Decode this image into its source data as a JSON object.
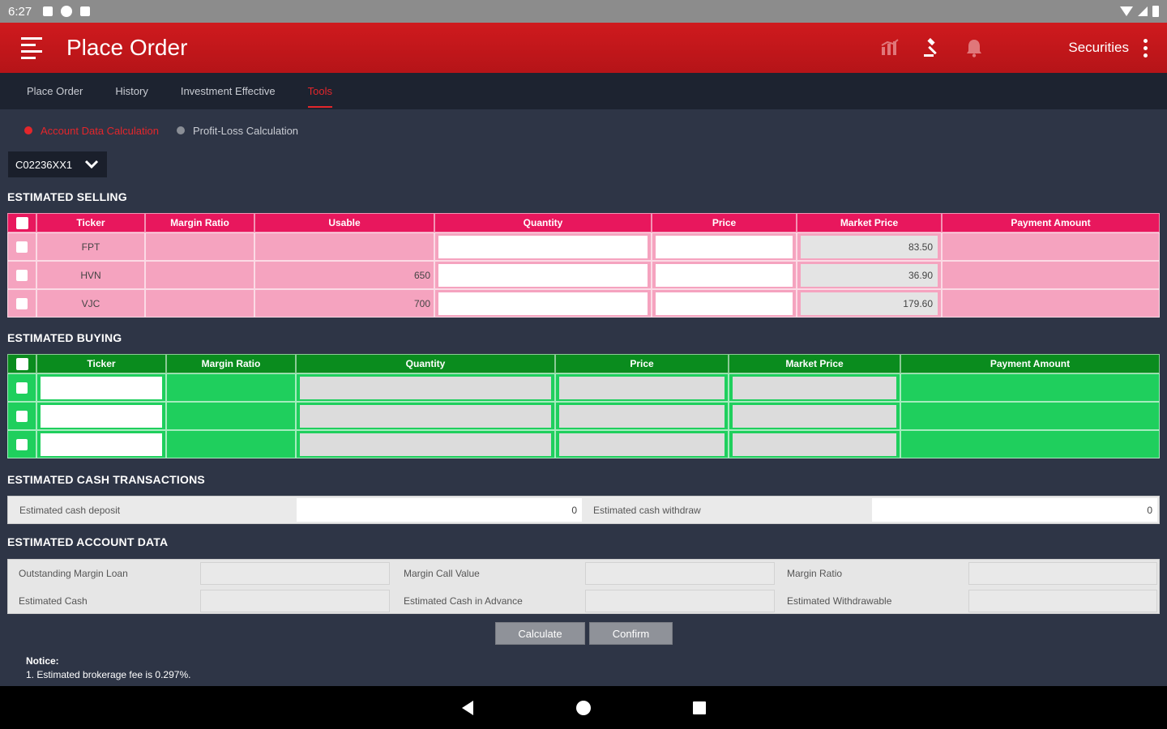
{
  "status_bar": {
    "time": "6:27"
  },
  "app_bar": {
    "title": "Place Order",
    "securities_label": "Securities"
  },
  "tabs": [
    {
      "label": "Place Order"
    },
    {
      "label": "History"
    },
    {
      "label": "Investment Effective"
    },
    {
      "label": "Tools",
      "active": true
    }
  ],
  "sub_tabs": [
    {
      "label": "Account Data Calculation",
      "active": true
    },
    {
      "label": "Profit-Loss Calculation"
    }
  ],
  "account": {
    "selected": "C02236XX1"
  },
  "selling": {
    "title": "ESTIMATED SELLING",
    "headers": [
      "Ticker",
      "Margin Ratio",
      "Usable",
      "Quantity",
      "Price",
      "Market Price",
      "Payment Amount"
    ],
    "rows": [
      {
        "ticker": "FPT",
        "margin_ratio": "",
        "usable": "",
        "market_price": "83.50",
        "payment": ""
      },
      {
        "ticker": "HVN",
        "margin_ratio": "",
        "usable": "650",
        "market_price": "36.90",
        "payment": ""
      },
      {
        "ticker": "VJC",
        "margin_ratio": "",
        "usable": "700",
        "market_price": "179.60",
        "payment": ""
      }
    ]
  },
  "buying": {
    "title": "ESTIMATED BUYING",
    "headers": [
      "Ticker",
      "Margin Ratio",
      "Quantity",
      "Price",
      "Market Price",
      "Payment Amount"
    ],
    "rows": [
      {},
      {},
      {}
    ]
  },
  "cash": {
    "title": "ESTIMATED CASH TRANSACTIONS",
    "deposit_label": "Estimated cash deposit",
    "deposit_value": "0",
    "withdraw_label": "Estimated cash withdraw",
    "withdraw_value": "0"
  },
  "account_data": {
    "title": "ESTIMATED ACCOUNT DATA",
    "outstanding_margin_loan": "Outstanding Margin Loan",
    "margin_call_value": "Margin Call Value",
    "margin_ratio": "Margin Ratio",
    "estimated_cash": "Estimated Cash",
    "estimated_cash_advance": "Estimated Cash in Advance",
    "estimated_withdrawable": "Estimated Withdrawable"
  },
  "buttons": {
    "calculate": "Calculate",
    "confirm": "Confirm"
  },
  "notice": {
    "title": "Notice:",
    "line1": "1. Estimated brokerage fee is 0.297%."
  },
  "colors": {
    "brand_red": "#cf1a1e",
    "sell_header": "#e8175d",
    "sell_row": "#f5a3bf",
    "buy_header": "#0a8c1e",
    "buy_row": "#1fcf5d"
  }
}
